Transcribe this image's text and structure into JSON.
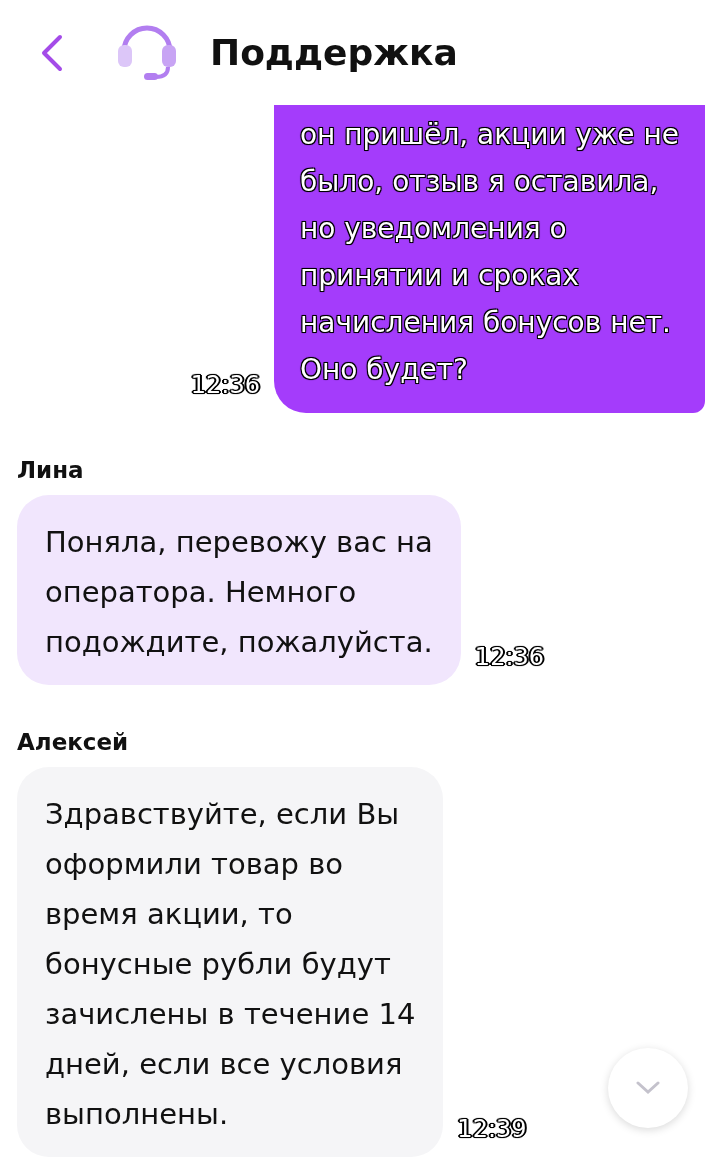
{
  "header": {
    "title": "Поддержка"
  },
  "messages": [
    {
      "kind": "outgoing",
      "text": "он пришёл, акции уже не\nбыло, отзыв я оставила,\nно уведомления о\nпринятии и сроках\nначисления бонусов нет.\nОно будет?",
      "time": "12:36"
    },
    {
      "kind": "bot",
      "author": "Лина",
      "text": "Поняла, перевожу вас на\nоператора. Немного\nподождите, пожалуйста.",
      "time": "12:36"
    },
    {
      "kind": "operator",
      "author": "Алексей",
      "text": "Здравствуйте, если Вы\nоформили товар во\nвремя акции, то\nбонусные рубли будут\nзачислены в течение 14\nдней, если все условия\nвыполнены.",
      "time": "12:39"
    }
  ]
}
